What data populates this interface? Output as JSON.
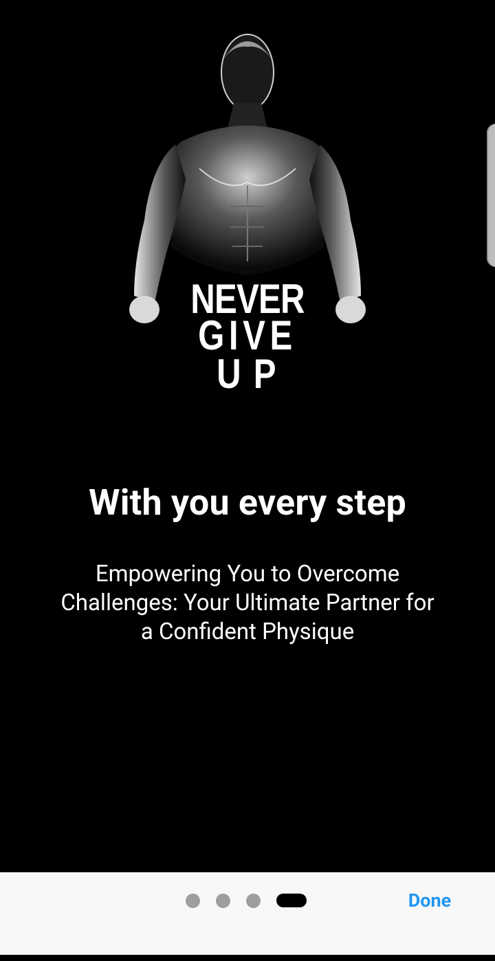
{
  "onboarding": {
    "hero": {
      "icon": "bodybuilder-silhouette-illustration",
      "poster_lines": [
        "NEVER",
        "GIVE",
        "UP"
      ]
    },
    "title": "With you every step",
    "subtitle": "Empowering You to Overcome Challenges: Your Ultimate Partner for a Confident Physique"
  },
  "pager": {
    "total_pages": 4,
    "current_page": 4
  },
  "footer": {
    "done_label": "Done"
  },
  "colors": {
    "background": "#000000",
    "bottom_bar": "#f8f8f8",
    "accent": "#2196f3",
    "dot_inactive": "#9e9e9e",
    "dot_active": "#000000"
  }
}
